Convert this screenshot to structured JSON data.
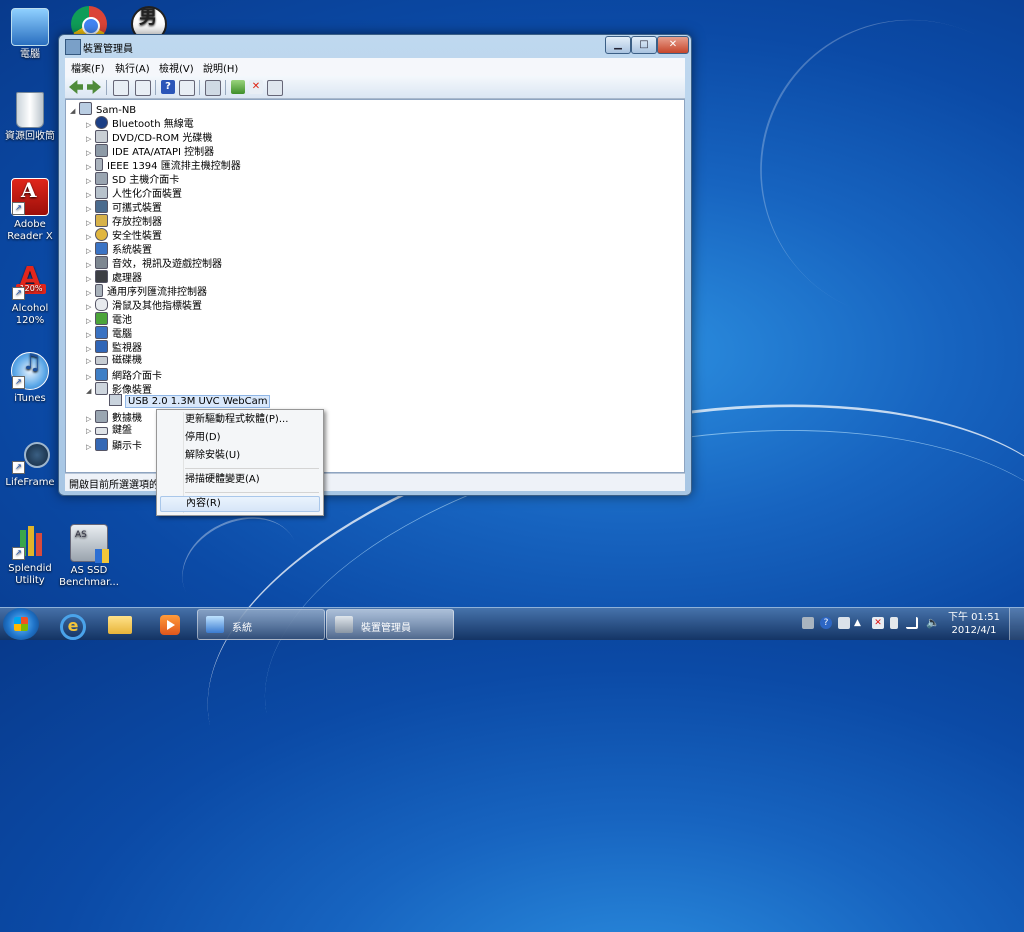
{
  "desktop": {
    "icons": [
      {
        "label": "電腦"
      },
      {
        "label": ""
      },
      {
        "label": ""
      },
      {
        "label": "資源回收筒"
      },
      {
        "label": "Adobe Reader X"
      },
      {
        "label": "Alcohol 120%"
      },
      {
        "label": "iTunes"
      },
      {
        "label": "LifeFrame"
      },
      {
        "label": "Splendid Utility"
      },
      {
        "label": "AS SSD Benchmar..."
      }
    ]
  },
  "window": {
    "title": "裝置管理員",
    "controls": {
      "minimize": "▁",
      "maximize": "□",
      "close": "✕"
    },
    "menu": [
      "檔案(F)",
      "執行(A)",
      "檢視(V)",
      "說明(H)"
    ],
    "tree": {
      "root": "Sam-NB",
      "categories": [
        "Bluetooth 無線電",
        "DVD/CD-ROM 光碟機",
        "IDE ATA/ATAPI 控制器",
        "IEEE 1394 匯流排主機控制器",
        "SD 主機介面卡",
        "人性化介面裝置",
        "可攜式裝置",
        "存放控制器",
        "安全性裝置",
        "系統裝置",
        "音效，視訊及遊戲控制器",
        "處理器",
        "通用序列匯流排控制器",
        "滑鼠及其他指標裝置",
        "電池",
        "電腦",
        "監視器",
        "磁碟機",
        "網路介面卡",
        "影像裝置",
        "數據機",
        "鍵盤",
        "顯示卡"
      ],
      "expanded_child": "USB 2.0 1.3M UVC WebCam"
    },
    "status": "開啟目前所選選項的內容頁。"
  },
  "context_menu": {
    "items": [
      "更新驅動程式軟體(P)...",
      "停用(D)",
      "解除安裝(U)",
      "掃描硬體變更(A)",
      "內容(R)"
    ]
  },
  "taskbar": {
    "tasks": [
      {
        "label": "系統"
      },
      {
        "label": "裝置管理員"
      }
    ],
    "clock": {
      "time": "下午 01:51",
      "date": "2012/4/1"
    }
  }
}
